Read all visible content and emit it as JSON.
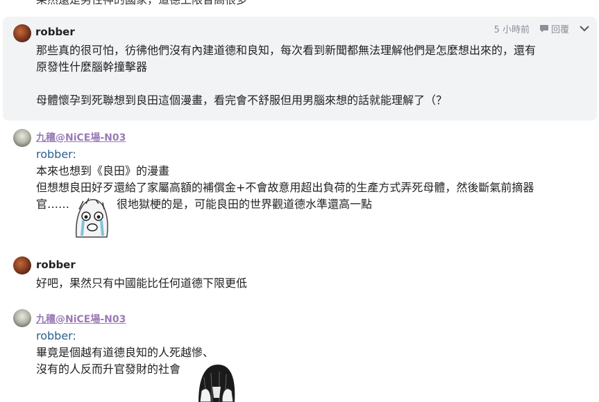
{
  "top_cut_line": "果然還是男性神的國家，道德上限普高很多",
  "comments": [
    {
      "author": "robber",
      "time": "5 小時前",
      "reply_label": "回覆",
      "lines": [
        "那些真的很可怕，彷彿他們沒有內建道德和良知，每次看到新聞都無法理解他們是怎麼想出來的，還有",
        "原發性什麼腦幹撞擊器",
        "",
        "母體懷孕到死聯想到良田這個漫畫，看完會不舒服但用男腦來想的話就能理解了（？"
      ]
    },
    {
      "author": "九穰@NiCE場-N03",
      "quote": "robber:",
      "lines": [
        "本來也想到《良田》的漫畫",
        "但想想良田好歹還給了家屬高額的補償金+不會故意用超出負荷的生產方式弄死母體，然後斷氣前摘器",
        "官……",
        "很地獄梗的是，可能良田的世界觀道德水準還高一點"
      ]
    },
    {
      "author": "robber",
      "lines": [
        "好吧，果然只有中國能比任何道德下限更低"
      ]
    },
    {
      "author": "九穰@NiCE場-N03",
      "quote": "robber:",
      "lines": [
        "畢竟是個越有道德良知的人死越慘、",
        "沒有的人反而升官發財的社會"
      ]
    }
  ]
}
